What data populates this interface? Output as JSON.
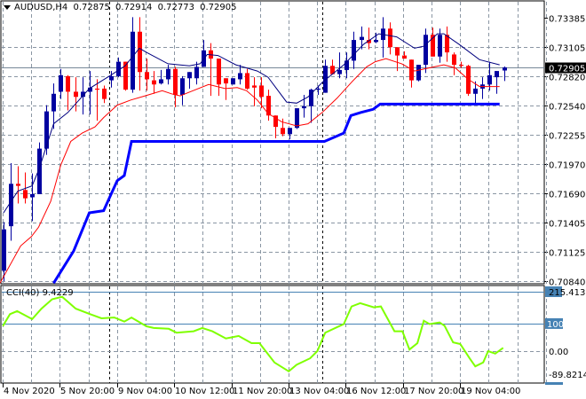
{
  "header": {
    "symbol": "AUDUSD,H4",
    "open": "0.72875",
    "high": "0.72914",
    "low": "0.72773",
    "close": "0.72905"
  },
  "cci_label": {
    "name": "CCI(40)",
    "value": "9.4229"
  },
  "colors": {
    "bull": "#0000a0",
    "bear": "#ff0000",
    "ma_fast": "#00007f",
    "ma_slow": "#ff0000",
    "stop_line": "#0000ff",
    "cci": "#7fff00",
    "level": "#4682b4",
    "grid": "#8a96a3"
  },
  "current_price_label": "0.72905",
  "cci_axis": {
    "top_label": "215.413",
    "level_100": "100",
    "zero": "0.00",
    "bottom_label": "-89.8214"
  },
  "chart_data": [
    {
      "type": "candlestick",
      "title": "AUDUSD,H4",
      "ylim": [
        0.7084,
        0.73385
      ],
      "price_ticks": [
        "0.73385",
        "0.73105",
        "0.72820",
        "0.72540",
        "0.72255",
        "0.71970",
        "0.71690",
        "0.71405",
        "0.71125",
        "0.70840"
      ],
      "time_ticks": [
        {
          "index": 1,
          "label": "4 Nov 2020"
        },
        {
          "index": 9,
          "label": "5 Nov 20:00"
        },
        {
          "index": 17,
          "label": "9 Nov 04:00"
        },
        {
          "index": 25,
          "label": "10 Nov 12:00"
        },
        {
          "index": 33,
          "label": "11 Nov 20:00"
        },
        {
          "index": 41,
          "label": "13 Nov 04:00"
        },
        {
          "index": 49,
          "label": "16 Nov 12:00"
        },
        {
          "index": 57,
          "label": "17 Nov 20:00"
        },
        {
          "index": 65,
          "label": "19 Nov 04:00"
        }
      ],
      "ohlc": [
        [
          0.7094,
          0.7141,
          0.7084,
          0.7134
        ],
        [
          0.7137,
          0.7198,
          0.7123,
          0.7178
        ],
        [
          0.7178,
          0.7195,
          0.7159,
          0.7176
        ],
        [
          0.7172,
          0.7189,
          0.7159,
          0.7164
        ],
        [
          0.7165,
          0.7188,
          0.7142,
          0.7168
        ],
        [
          0.7168,
          0.7218,
          0.7168,
          0.7212
        ],
        [
          0.7212,
          0.7254,
          0.7206,
          0.7248
        ],
        [
          0.7248,
          0.7275,
          0.7231,
          0.7265
        ],
        [
          0.7267,
          0.7289,
          0.726,
          0.7283
        ],
        [
          0.7282,
          0.7283,
          0.7249,
          0.7267
        ],
        [
          0.7267,
          0.7281,
          0.7248,
          0.7262
        ],
        [
          0.7262,
          0.7281,
          0.7245,
          0.7267
        ],
        [
          0.7267,
          0.7287,
          0.7245,
          0.7271
        ],
        [
          0.727,
          0.7279,
          0.7239,
          0.7269
        ],
        [
          0.727,
          0.7273,
          0.7256,
          0.726
        ],
        [
          0.7278,
          0.7287,
          0.7271,
          0.7282
        ],
        [
          0.7282,
          0.73,
          0.7281,
          0.7296
        ],
        [
          0.7296,
          0.7296,
          0.7268,
          0.7269
        ],
        [
          0.7269,
          0.7339,
          0.7266,
          0.7325
        ],
        [
          0.7325,
          0.7339,
          0.7268,
          0.7286
        ],
        [
          0.7286,
          0.7299,
          0.7268,
          0.7279
        ],
        [
          0.7278,
          0.7287,
          0.7265,
          0.7274
        ],
        [
          0.7275,
          0.7288,
          0.7274,
          0.7279
        ],
        [
          0.7279,
          0.7293,
          0.7274,
          0.7289
        ],
        [
          0.7289,
          0.7291,
          0.7252,
          0.7264
        ],
        [
          0.7264,
          0.7282,
          0.7254,
          0.728
        ],
        [
          0.728,
          0.7286,
          0.727,
          0.7286
        ],
        [
          0.728,
          0.7296,
          0.7274,
          0.7291
        ],
        [
          0.7291,
          0.7317,
          0.7291,
          0.7307
        ],
        [
          0.7307,
          0.7314,
          0.7263,
          0.7299
        ],
        [
          0.7299,
          0.7299,
          0.7263,
          0.7274
        ],
        [
          0.728,
          0.728,
          0.7259,
          0.7275
        ],
        [
          0.7274,
          0.728,
          0.7274,
          0.728
        ],
        [
          0.7279,
          0.7293,
          0.7274,
          0.7285
        ],
        [
          0.7285,
          0.7289,
          0.7269,
          0.727
        ],
        [
          0.7273,
          0.7281,
          0.7253,
          0.7271
        ],
        [
          0.7273,
          0.7281,
          0.7251,
          0.7262
        ],
        [
          0.7263,
          0.7269,
          0.7239,
          0.7244
        ],
        [
          0.7244,
          0.7244,
          0.7222,
          0.7233
        ],
        [
          0.7232,
          0.7241,
          0.7224,
          0.7226
        ],
        [
          0.7226,
          0.7232,
          0.7221,
          0.7232
        ],
        [
          0.7232,
          0.7251,
          0.7231,
          0.7251
        ],
        [
          0.7251,
          0.7264,
          0.7242,
          0.7253
        ],
        [
          0.7253,
          0.727,
          0.7237,
          0.7269
        ],
        [
          0.7269,
          0.7273,
          0.7264,
          0.727
        ],
        [
          0.7266,
          0.7298,
          0.7266,
          0.7292
        ],
        [
          0.7292,
          0.7298,
          0.7284,
          0.7284
        ],
        [
          0.7284,
          0.7305,
          0.728,
          0.7288
        ],
        [
          0.7288,
          0.7305,
          0.728,
          0.7297
        ],
        [
          0.7297,
          0.7325,
          0.7289,
          0.7317
        ],
        [
          0.7317,
          0.733,
          0.7308,
          0.732
        ],
        [
          0.7317,
          0.7329,
          0.7308,
          0.7314
        ],
        [
          0.7315,
          0.7324,
          0.7314,
          0.7317
        ],
        [
          0.7317,
          0.7339,
          0.73,
          0.7328
        ],
        [
          0.7328,
          0.7334,
          0.7303,
          0.731
        ],
        [
          0.731,
          0.731,
          0.7287,
          0.7302
        ],
        [
          0.7302,
          0.7306,
          0.7299,
          0.7299
        ],
        [
          0.7298,
          0.7298,
          0.7271,
          0.7278
        ],
        [
          0.7278,
          0.7293,
          0.7277,
          0.7293
        ],
        [
          0.7293,
          0.7328,
          0.7285,
          0.7322
        ],
        [
          0.7322,
          0.7329,
          0.7301,
          0.7301
        ],
        [
          0.7301,
          0.7328,
          0.7295,
          0.7322
        ],
        [
          0.7322,
          0.733,
          0.7296,
          0.7305
        ],
        [
          0.7303,
          0.7305,
          0.7283,
          0.7293
        ],
        [
          0.7293,
          0.7296,
          0.729,
          0.7292
        ],
        [
          0.7292,
          0.7293,
          0.7263,
          0.7265
        ],
        [
          0.7265,
          0.7277,
          0.7255,
          0.727
        ],
        [
          0.727,
          0.7281,
          0.726,
          0.7274
        ],
        [
          0.7274,
          0.7296,
          0.7268,
          0.7283
        ],
        [
          0.7281,
          0.7287,
          0.7265,
          0.7287
        ],
        [
          0.72875,
          0.72914,
          0.72773,
          0.72905
        ]
      ],
      "ma_fast": [
        [
          1,
          0.715
        ],
        [
          3,
          0.7171
        ],
        [
          5,
          0.7176
        ],
        [
          6,
          0.7193
        ],
        [
          8,
          0.7236
        ],
        [
          10,
          0.7247
        ],
        [
          13,
          0.727
        ],
        [
          16,
          0.7283
        ],
        [
          18,
          0.7292
        ],
        [
          20,
          0.7309
        ],
        [
          21,
          0.7305
        ],
        [
          24,
          0.7294
        ],
        [
          27,
          0.7292
        ],
        [
          28.5,
          0.7294
        ],
        [
          29.5,
          0.7303
        ],
        [
          31,
          0.7302
        ],
        [
          33.5,
          0.7293
        ],
        [
          36.5,
          0.7287
        ],
        [
          38,
          0.7281
        ],
        [
          40.6,
          0.7257
        ],
        [
          42,
          0.7256
        ],
        [
          43.6,
          0.7262
        ],
        [
          45.6,
          0.7276
        ],
        [
          48.6,
          0.7293
        ],
        [
          51.4,
          0.7313
        ],
        [
          53.5,
          0.7323
        ],
        [
          56,
          0.732
        ],
        [
          58.5,
          0.7309
        ],
        [
          59.8,
          0.7311
        ],
        [
          61.7,
          0.7323
        ],
        [
          62.6,
          0.7323
        ],
        [
          64.7,
          0.7313
        ],
        [
          67.6,
          0.7298
        ],
        [
          70.4,
          0.7293
        ]
      ],
      "ma_slow": [
        [
          0.5,
          0.7082
        ],
        [
          3.4,
          0.7118
        ],
        [
          4.9,
          0.7127
        ],
        [
          5.9,
          0.7136
        ],
        [
          7.6,
          0.7161
        ],
        [
          9,
          0.7196
        ],
        [
          10.4,
          0.7219
        ],
        [
          12,
          0.7227
        ],
        [
          13.8,
          0.7233
        ],
        [
          15,
          0.7242
        ],
        [
          16.9,
          0.7254
        ],
        [
          18.8,
          0.7259
        ],
        [
          20.8,
          0.7263
        ],
        [
          23.2,
          0.7268
        ],
        [
          24.5,
          0.7265
        ],
        [
          25.7,
          0.7263
        ],
        [
          27.5,
          0.7268
        ],
        [
          29.7,
          0.7274
        ],
        [
          32,
          0.727
        ],
        [
          33.7,
          0.7271
        ],
        [
          35,
          0.7268
        ],
        [
          36.5,
          0.7259
        ],
        [
          38,
          0.7246
        ],
        [
          39.9,
          0.7238
        ],
        [
          42,
          0.7234
        ],
        [
          43.6,
          0.7236
        ],
        [
          45.6,
          0.7247
        ],
        [
          47.7,
          0.7261
        ],
        [
          49.8,
          0.7277
        ],
        [
          51.8,
          0.7291
        ],
        [
          53,
          0.7296
        ],
        [
          54.5,
          0.7299
        ],
        [
          56.7,
          0.7294
        ],
        [
          58.5,
          0.7287
        ],
        [
          60.5,
          0.729
        ],
        [
          62.6,
          0.7293
        ],
        [
          64.2,
          0.729
        ],
        [
          66,
          0.7279
        ],
        [
          67.6,
          0.7272
        ],
        [
          70.4,
          0.7272
        ]
      ],
      "stop_line": [
        [
          8,
          0.7082
        ],
        [
          10.8,
          0.7113
        ],
        [
          13,
          0.715
        ],
        [
          15,
          0.7152
        ],
        [
          16.9,
          0.7181
        ],
        [
          17.9,
          0.7186
        ],
        [
          18.9,
          0.7219
        ],
        [
          45.9,
          0.7219
        ],
        [
          48.6,
          0.7227
        ],
        [
          49.6,
          0.7244
        ],
        [
          51,
          0.7247
        ],
        [
          52.7,
          0.725
        ],
        [
          53.7,
          0.7255
        ],
        [
          70.4,
          0.7255
        ]
      ]
    },
    {
      "type": "line",
      "title": "CCI(40)",
      "ylim": [
        -89.8214,
        215.413
      ],
      "levels": [
        215.413,
        100,
        0
      ],
      "points": [
        [
          0.9,
          91
        ],
        [
          1.9,
          134
        ],
        [
          2.9,
          145
        ],
        [
          5,
          116
        ],
        [
          6.3,
          154
        ],
        [
          7.8,
          188
        ],
        [
          9.2,
          197
        ],
        [
          11.1,
          154
        ],
        [
          13.2,
          133
        ],
        [
          14.7,
          119
        ],
        [
          16.5,
          122
        ],
        [
          17.9,
          107
        ],
        [
          18.9,
          122
        ],
        [
          21,
          90
        ],
        [
          22,
          84
        ],
        [
          24.1,
          81
        ],
        [
          25.2,
          67
        ],
        [
          27.6,
          72
        ],
        [
          28.8,
          84
        ],
        [
          30.2,
          72
        ],
        [
          32.1,
          46
        ],
        [
          33.9,
          55
        ],
        [
          35.7,
          29
        ],
        [
          36.8,
          29
        ],
        [
          38.9,
          -41
        ],
        [
          40.9,
          -73
        ],
        [
          42,
          -49
        ],
        [
          43.9,
          -26
        ],
        [
          44.9,
          0
        ],
        [
          46,
          67
        ],
        [
          48.6,
          98
        ],
        [
          49.7,
          162
        ],
        [
          50.9,
          174
        ],
        [
          52.8,
          159
        ],
        [
          53.8,
          162
        ],
        [
          55.7,
          72
        ],
        [
          56.8,
          72
        ],
        [
          57.8,
          6
        ],
        [
          58.9,
          29
        ],
        [
          59.8,
          110
        ],
        [
          60.6,
          98
        ],
        [
          62,
          104
        ],
        [
          62.7,
          92
        ],
        [
          63.9,
          32
        ],
        [
          64.9,
          26
        ],
        [
          66.2,
          -26
        ],
        [
          67,
          -55
        ],
        [
          68.1,
          -41
        ],
        [
          68.8,
          0
        ],
        [
          69.8,
          -9
        ],
        [
          70.9,
          12
        ]
      ]
    }
  ]
}
